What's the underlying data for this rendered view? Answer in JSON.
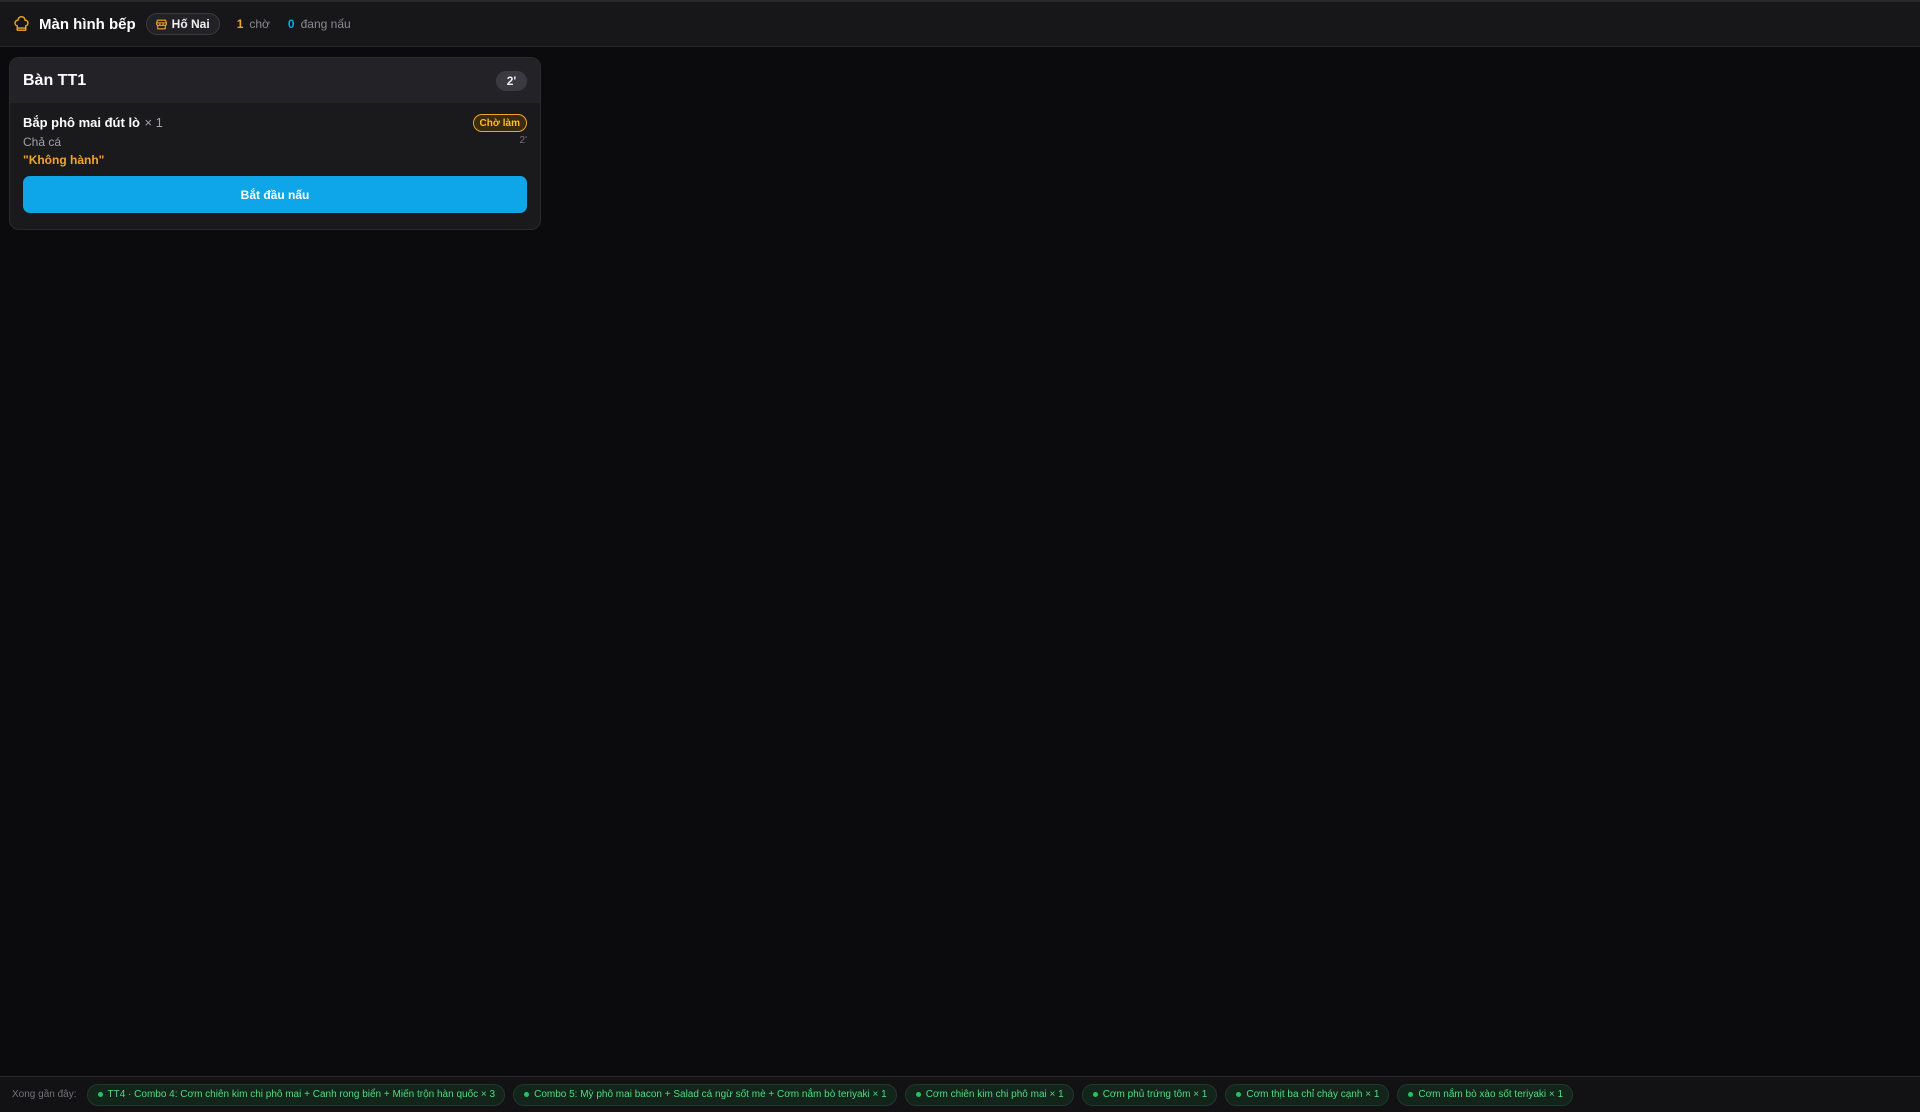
{
  "header": {
    "title": "Màn hình bếp",
    "store": "Hố Nai",
    "waiting_count": "1",
    "waiting_label": "chờ",
    "cooking_count": "0",
    "cooking_label": "đang nấu"
  },
  "ticket": {
    "table": "Bàn TT1",
    "elapsed": "2'",
    "item": {
      "name": "Bắp phô mai đút lò",
      "qty": "× 1",
      "status": "Chờ làm",
      "variant": "Chả cá",
      "time": "2'",
      "note": "\"Không hành\""
    },
    "action_label": "Bắt đầu nấu"
  },
  "recent": {
    "label": "Xong gần đây:",
    "items": [
      "TT4 · Combo 4: Cơm chiên kim chi phô mai + Canh rong biển + Miến trộn hàn quốc × 3",
      "Combo 5: Mỳ phô mai bacon + Salad cá ngừ sốt mè + Cơm nắm bò teriyaki × 1",
      "Cơm chiên kim chi phô mai × 1",
      "Cơm phủ trứng tôm × 1",
      "Cơm thịt ba chỉ cháy cạnh × 1",
      "Cơm nắm bò xào sốt teriyaki × 1"
    ]
  },
  "colors": {
    "accent": "#0ea5e9",
    "waiting": "#f5a524",
    "done": "#22c55e",
    "background": "#0b0b0d"
  },
  "icons": {
    "title": "chef-hat-icon",
    "store": "store-icon",
    "done": "dot-icon"
  }
}
